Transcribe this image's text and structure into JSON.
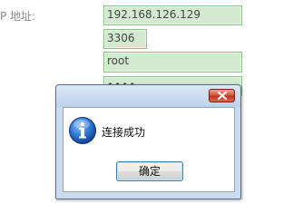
{
  "form": {
    "host_label": "P 地址:",
    "host_value": "192.168.126.129",
    "port_value": "3306",
    "user_value": "root",
    "password_value": "••••"
  },
  "dialog": {
    "message": "连接成功",
    "ok_label": "确定",
    "icon": "info-icon",
    "close_icon": "close-icon"
  },
  "colors": {
    "field_bg": "#d3ead1",
    "field_border": "#8cbf88",
    "dialog_frame": "#c9dcef",
    "close_red": "#c2371d",
    "info_blue": "#1f62c4"
  }
}
